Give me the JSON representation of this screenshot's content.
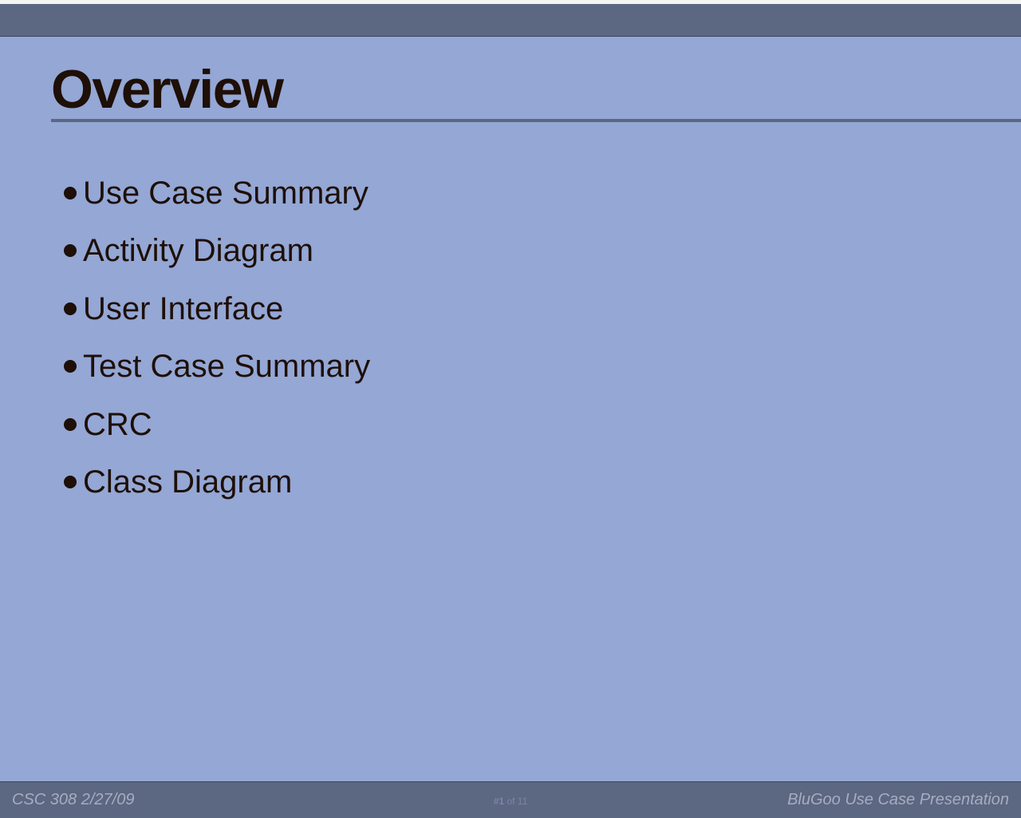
{
  "slide": {
    "title": "Overview",
    "bullets": [
      "Use Case Summary",
      "Activity Diagram",
      "User Interface",
      "Test Case Summary",
      "CRC",
      "Class Diagram"
    ]
  },
  "footer": {
    "left": "CSC 308 2/27/09",
    "right": "BluGoo Use Case Presentation",
    "page_current": "#1",
    "page_total": "of 11"
  },
  "colors": {
    "background": "#94a7d5",
    "bars": "#5c6782",
    "text": "#1e0f07",
    "footer_text": "#a6adc0"
  }
}
